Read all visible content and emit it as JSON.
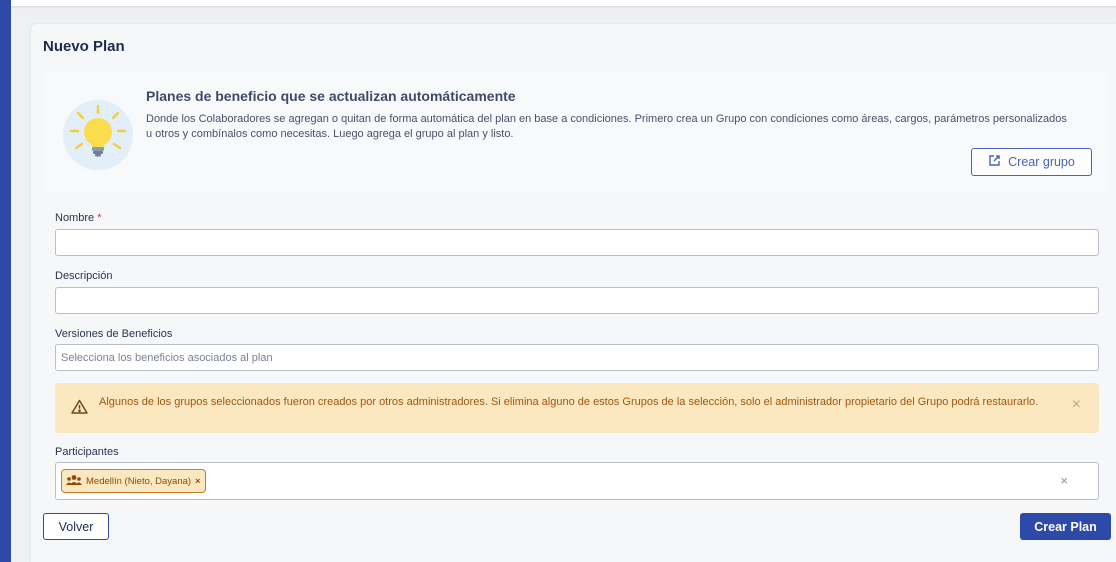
{
  "page": {
    "title": "Nuevo Plan"
  },
  "info": {
    "title": "Planes de beneficio que se actualizan automáticamente",
    "text": "Donde los Colaboradores se agregan o quitan de forma automática del plan en base a condiciones. Primero crea un Grupo con condiciones como áreas, cargos, parámetros personalizados u otros y combínalos como necesitas. Luego agrega el grupo al plan y listo.",
    "create_group_label": "Crear grupo",
    "icon": "lightbulb-icon"
  },
  "form": {
    "name_label": "Nombre",
    "required_mark": "*",
    "name_value": "",
    "description_label": "Descripción",
    "description_value": "",
    "versions_label": "Versiones de Beneficios",
    "versions_placeholder": "Selecciona los beneficios asociados al plan",
    "participants_label": "Participantes"
  },
  "alert": {
    "text": "Algunos de los grupos seleccionados fueron creados por otros administradores. Si elimina alguno de estos Grupos de la selección, solo el administrador propietario del Grupo podrá restaurarlo.",
    "close_glyph": "×",
    "color": "#fbe8c0"
  },
  "participants": {
    "chips": [
      {
        "label": "Medellín (Nieto, Dayana)",
        "remove_glyph": "×"
      }
    ],
    "clear_glyph": "×"
  },
  "actions": {
    "back_label": "Volver",
    "create_plan_label": "Crear Plan"
  },
  "colors": {
    "accent": "#2d4aa8",
    "warning_text": "#a1560d"
  }
}
